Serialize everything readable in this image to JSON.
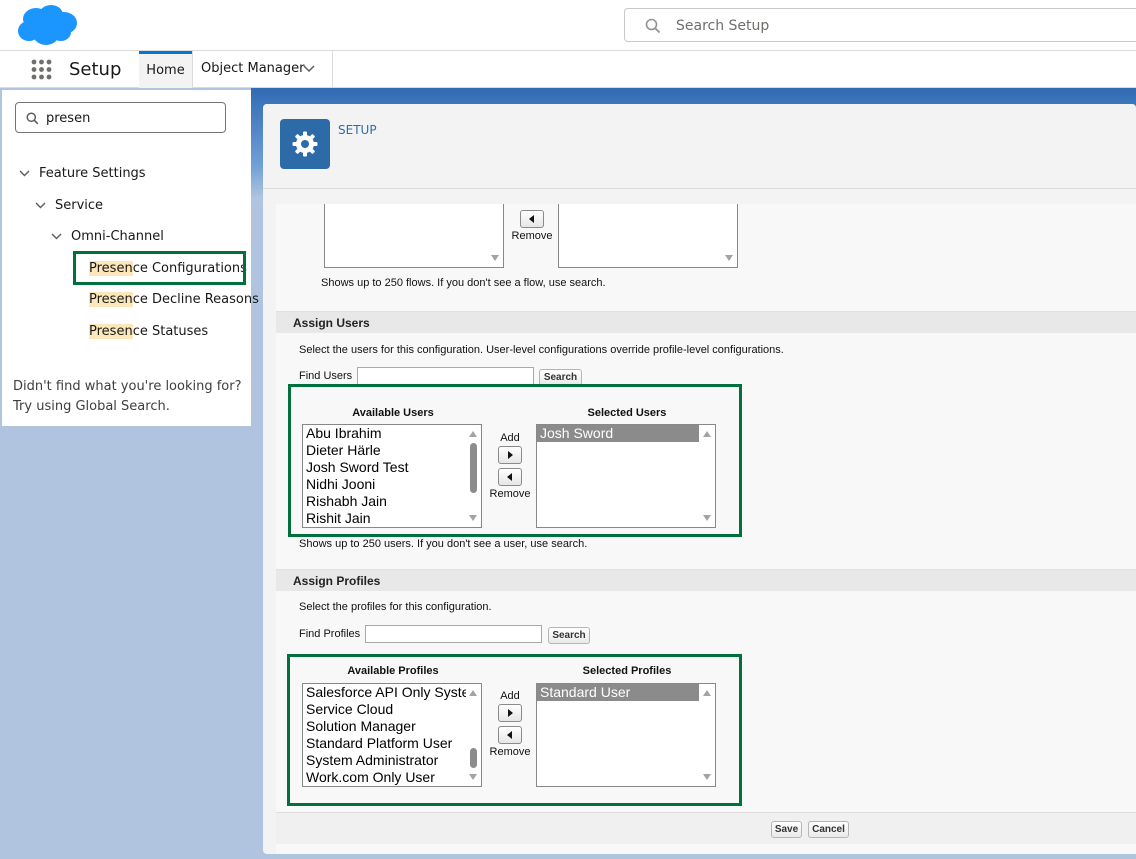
{
  "header": {
    "search_placeholder": "Search Setup",
    "brand_color": "#1b96ff"
  },
  "nav": {
    "app_name": "Setup",
    "tabs": [
      {
        "label": "Home",
        "active": true
      },
      {
        "label": "Object Manager",
        "active": false
      }
    ]
  },
  "sidebar": {
    "quick_find_value": "presen",
    "tree": {
      "feature_settings": "Feature Settings",
      "service": "Service",
      "omni_channel": "Omni-Channel",
      "items": [
        {
          "match": "Presen",
          "rest": "ce Configurations",
          "selected": true
        },
        {
          "match": "Presen",
          "rest": "ce Decline Reasons",
          "selected": false
        },
        {
          "match": "Presen",
          "rest": "ce Statuses",
          "selected": false
        }
      ]
    },
    "not_found_text": "Didn't find what you're looking for? Try using Global Search."
  },
  "page_header": {
    "crumb": "SETUP",
    "icon": "gear-icon"
  },
  "flows": {
    "remove_label": "Remove",
    "note": "Shows up to 250 flows. If you don't see a flow, use search."
  },
  "assign_users": {
    "title": "Assign Users",
    "instructions": "Select the users for this configuration. User-level configurations override profile-level configurations.",
    "find_label": "Find Users",
    "find_value": "",
    "search_label": "Search",
    "available_title": "Available Users",
    "selected_title": "Selected Users",
    "available": [
      "Abu Ibrahim",
      "Dieter Härle",
      "Josh Sword Test",
      "Nidhi Jooni",
      "Rishabh Jain",
      "Rishit Jain"
    ],
    "selected": [
      "Josh Sword"
    ],
    "add_label": "Add",
    "remove_label": "Remove",
    "note": "Shows up to 250 users. If you don't see a user, use search."
  },
  "assign_profiles": {
    "title": "Assign Profiles",
    "instructions": "Select the profiles for this configuration.",
    "find_label": "Find Profiles",
    "find_value": "",
    "search_label": "Search",
    "available_title": "Available Profiles",
    "selected_title": "Selected Profiles",
    "available": [
      "Salesforce API Only System",
      "Service Cloud",
      "Solution Manager",
      "Standard Platform User",
      "System Administrator",
      "Work.com Only User"
    ],
    "selected": [
      "Standard User"
    ],
    "add_label": "Add",
    "remove_label": "Remove"
  },
  "footer": {
    "save_label": "Save",
    "cancel_label": "Cancel"
  }
}
